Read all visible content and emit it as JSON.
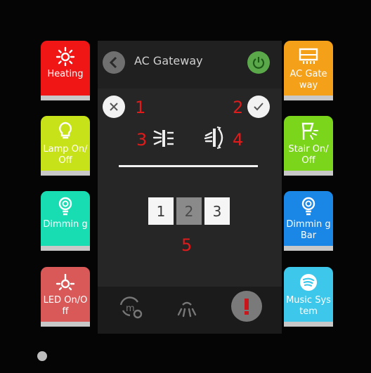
{
  "header": {
    "title": "AC Gateway"
  },
  "left_tiles": [
    {
      "label": "Heating",
      "icon": "sun-icon",
      "color": "#f01616"
    },
    {
      "label": "Lamp On/Off",
      "icon": "bulb-icon",
      "color": "#c8e21a"
    },
    {
      "label": "Dimmin g",
      "icon": "dimmer-bulb-icon",
      "color": "#18ddb2"
    },
    {
      "label": "LED On/Off",
      "icon": "led-icon",
      "color": "#d95858"
    }
  ],
  "right_tiles": [
    {
      "label": "AC Gate way",
      "icon": "ac-unit-icon",
      "color": "#f4a019"
    },
    {
      "label": "Stair On/Off",
      "icon": "stair-light-icon",
      "color": "#7ad51b"
    },
    {
      "label": "Dimmin g Bar",
      "icon": "dimmer-bulb-icon",
      "color": "#1a87e6"
    },
    {
      "label": "Music System",
      "icon": "spotify-icon",
      "color": "#3dc7ea"
    }
  ],
  "annotations": {
    "n1": "1",
    "n2": "2",
    "n3": "3",
    "n4": "4",
    "n5": "5"
  },
  "segments": [
    {
      "label": "1",
      "selected": false
    },
    {
      "label": "2",
      "selected": true
    },
    {
      "label": "3",
      "selected": false
    }
  ],
  "footer": {
    "icons": [
      "schedule-settings-icon",
      "lamp-rays-icon",
      "alert-icon"
    ]
  }
}
